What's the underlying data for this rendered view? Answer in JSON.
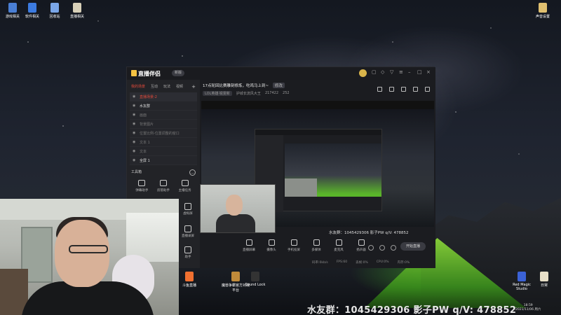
{
  "desktop": {
    "icons_left": [
      {
        "label": "游戏相关",
        "name": "desktop-icon-games",
        "color": "#4a7fd4"
      },
      {
        "label": "软件相关",
        "name": "desktop-icon-software",
        "color": "#3c7be0"
      },
      {
        "label": "回收站",
        "name": "desktop-icon-recycle-bin",
        "color": "#7aa6e8"
      },
      {
        "label": "直播相关",
        "name": "desktop-icon-live",
        "color": "#d8d0b8"
      }
    ],
    "icon_top_right": {
      "label": "声音设置",
      "name": "desktop-icon-sound-settings",
      "color": "#e0c070"
    },
    "icons_bottom": [
      {
        "label": "斗鱼直播",
        "name": "desktop-icon-douyu",
        "color": "#f07030"
      },
      {
        "label": "魔兽争霸官方对战平台",
        "name": "desktop-icon-warcraft-platform",
        "color": "#c08a3a"
      },
      {
        "label": "Sound Lock",
        "name": "desktop-icon-sound-lock",
        "color": "#333333"
      },
      {
        "label": "Red Magic Studio",
        "name": "desktop-icon-red-magic-studio",
        "color": "#3b62d6"
      },
      {
        "label": "日常",
        "name": "desktop-icon-daily",
        "color": "#e8e0c8"
      }
    ]
  },
  "app": {
    "name": "直播伴侣",
    "version_label": "新版",
    "tabs": [
      "我的场景",
      "互动",
      "玩法",
      "视频"
    ],
    "scenes": [
      {
        "label": "直播场景-2",
        "state": "selected"
      },
      {
        "label": "水友群",
        "state": "visible"
      },
      {
        "label": "画面",
        "state": "hidden"
      },
      {
        "label": "背景图片",
        "state": "hidden"
      },
      {
        "label": "位置比例-位置调整的窗口",
        "state": "hidden"
      },
      {
        "label": "文本 1",
        "state": "hidden"
      },
      {
        "label": "文本",
        "state": "hidden"
      },
      {
        "label": "全屏 1",
        "state": "visible"
      }
    ],
    "tools_title": "工具箱",
    "tools": [
      "弹幕助手",
      "房管助手",
      "主播任务"
    ],
    "room_title": "17点轮回比赛雕刻修炼，吃鸡马上到~",
    "room_tag": "修改",
    "room_category": "LOL英雄·锐雯新",
    "room_host": "护城长流风大王",
    "room_number": "217422",
    "room_hot": "252",
    "fans_text": "水友群：1045429306  影子PW q/V: 478852",
    "controls": [
      "直播屏幕",
      "摄像头",
      "手机投屏",
      "多媒体",
      "麦克风",
      "扬声器"
    ],
    "start_label": "开始直播",
    "status": [
      "码率:0kb/s",
      "FPS:60",
      "丢帧:0%",
      "CPU:0%",
      "内存:0%"
    ]
  },
  "side_tools": [
    "虚拟屏",
    "直播录屏",
    "助手"
  ],
  "caption": "水友群：1045429306  影子PW q/V: 478852",
  "clock": {
    "time": "18:59",
    "date": "2021/11/06 周六"
  }
}
